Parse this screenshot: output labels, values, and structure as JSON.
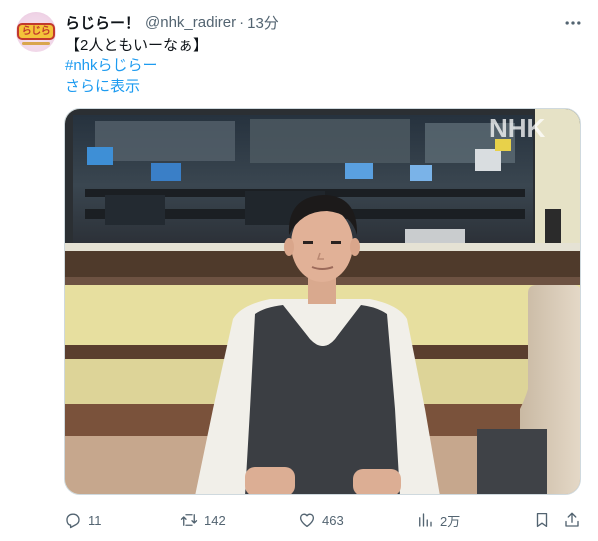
{
  "account": {
    "display_name": "らじらー！",
    "handle": "@nhk_radirer",
    "separator": "·",
    "time": "13分",
    "avatar_text": "らじらー"
  },
  "post": {
    "text": "【2人ともいーなぁ】",
    "hashtag": "#nhkらじらー",
    "show_more": "さらに表示",
    "image_watermark": "NHK"
  },
  "actions": {
    "replies": "11",
    "reposts": "142",
    "likes": "463",
    "views": "2万"
  },
  "colors": {
    "link": "#1d9bf0",
    "secondary_text": "#536471",
    "primary_text": "#0f1419"
  }
}
